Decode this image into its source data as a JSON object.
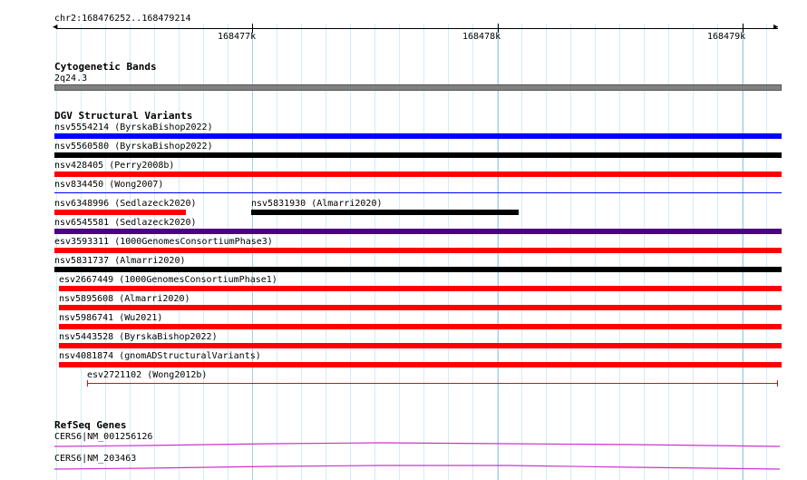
{
  "ruler": {
    "range_label": "chr2:168476252..168479214",
    "ticks": [
      "168477k",
      "168478k",
      "168479k"
    ]
  },
  "cytoband": {
    "title": "Cytogenetic Bands",
    "band_label": "2q24.3",
    "band_color": "#808080"
  },
  "dgv": {
    "title": "DGV Structural Variants",
    "features": [
      {
        "label": "nsv5554214 (ByrskaBishop2022)",
        "color": "#0000ff"
      },
      {
        "label": "nsv5560580 (ByrskaBishop2022)",
        "color": "#000000"
      },
      {
        "label": "nsv428405 (Perry2008b)",
        "color": "#ff0000"
      },
      {
        "label": "nsv834450 (Wong2007)",
        "color": "#0000ff"
      },
      {
        "label": "nsv6348996 (Sedlazeck2020)",
        "color": "#ff0000"
      },
      {
        "label": "nsv5831930 (Almarri2020)",
        "color": "#000000"
      },
      {
        "label": "nsv6545581 (Sedlazeck2020)",
        "color": "#4b0082"
      },
      {
        "label": "esv3593311 (1000GenomesConsortiumPhase3)",
        "color": "#ff0000"
      },
      {
        "label": "nsv5831737 (Almarri2020)",
        "color": "#000000"
      },
      {
        "label": "esv2667449 (1000GenomesConsortiumPhase1)",
        "color": "#ff0000"
      },
      {
        "label": "nsv5895608 (Almarri2020)",
        "color": "#ff0000"
      },
      {
        "label": "nsv5986741 (Wu2021)",
        "color": "#ff0000"
      },
      {
        "label": "nsv5443528 (ByrskaBishop2022)",
        "color": "#ff0000"
      },
      {
        "label": "nsv4081874 (gnomADStructuralVariants)",
        "color": "#ff0000"
      },
      {
        "label": "esv2721102 (Wong2012b)",
        "color": "#ff0000"
      }
    ]
  },
  "refseq": {
    "title": "RefSeq Genes",
    "transcripts": [
      {
        "label": "CERS6|NM_001256126",
        "color": "#cc33cc"
      },
      {
        "label": "CERS6|NM_203463",
        "color": "#cc33cc"
      }
    ]
  }
}
